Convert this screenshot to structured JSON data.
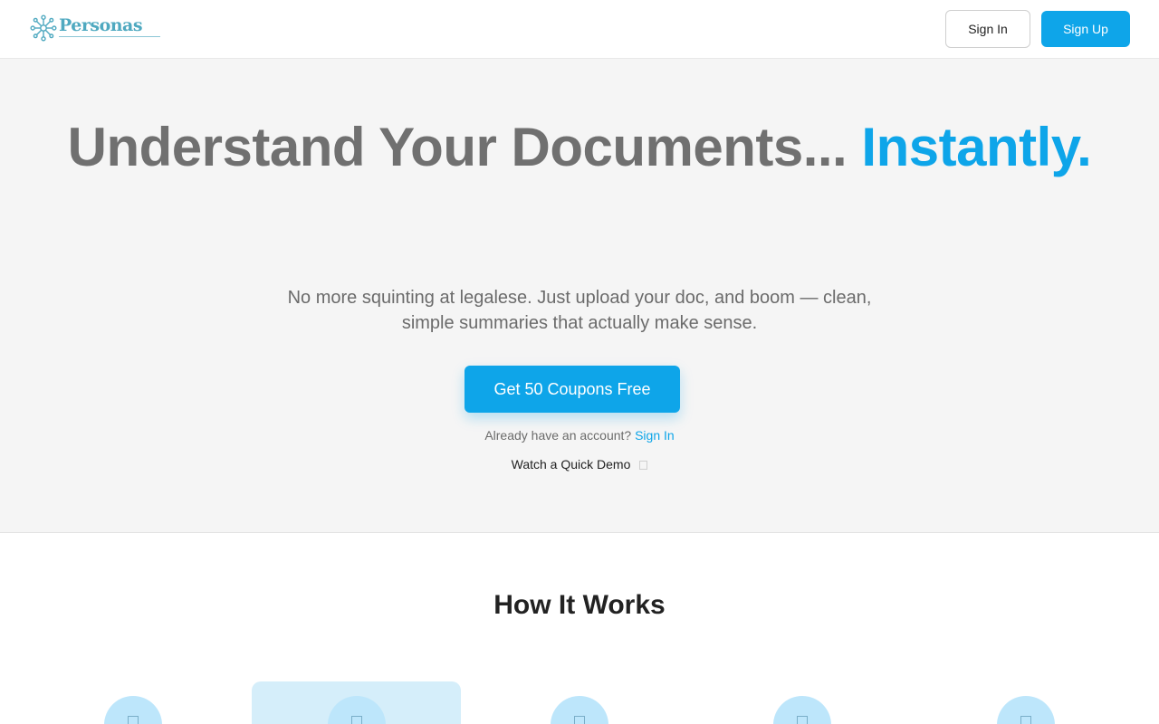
{
  "header": {
    "logo_text": "Personas",
    "signin_label": "Sign In",
    "signup_label": "Sign Up"
  },
  "hero": {
    "title_main": "Understand Your Documents...",
    "title_accent": "Instantly.",
    "subtitle": "No more squinting at legalese. Just upload your doc, and boom — clean, simple summaries that actually make sense.",
    "cta_label": "Get 50 Coupons Free",
    "account_prompt": "Already have an account?",
    "account_link": "Sign In",
    "demo_label": "Watch a Quick Demo"
  },
  "how": {
    "title": "How It Works"
  },
  "colors": {
    "accent": "#0ea5e9",
    "hero_bg": "#f5f5f5",
    "step_circle": "#bde6fb"
  }
}
